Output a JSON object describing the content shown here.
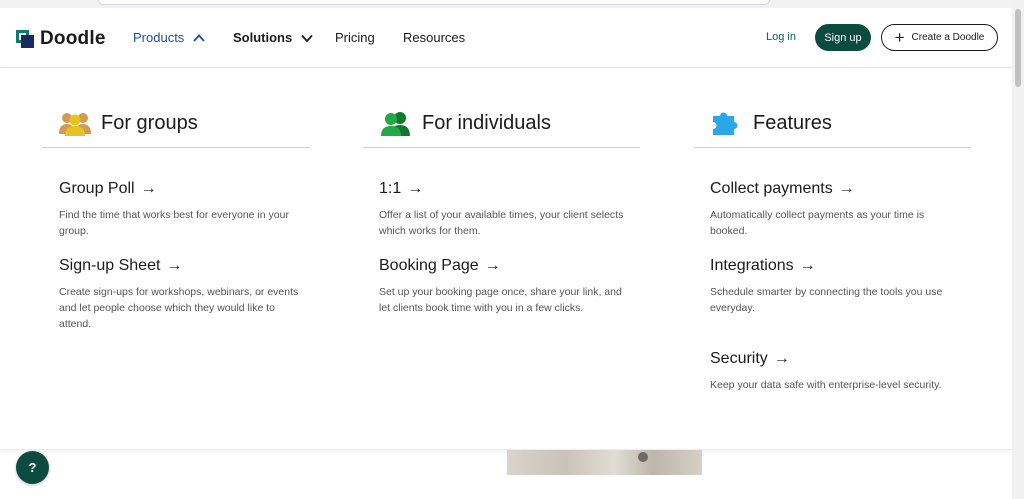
{
  "header": {
    "logo_text": "Doodle",
    "nav": [
      {
        "label": "Products",
        "icon": "chevron-up-icon"
      },
      {
        "label": "Solutions",
        "icon": "chevron-down-icon"
      },
      {
        "label": "Pricing"
      },
      {
        "label": "Resources"
      }
    ],
    "login_label": "Log in",
    "signup_label": "Sign up",
    "create_label": "Create a Doodle",
    "create_icon": "+"
  },
  "menu": {
    "groups": {
      "heading": "For groups",
      "icon": "group-icon",
      "icon_color": "#c98a3c",
      "items": [
        {
          "title": "Group Poll",
          "desc": "Find the time that works best for everyone in your group."
        },
        {
          "title": "Sign-up Sheet",
          "desc": "Create sign-ups for workshops, webinars, or events and let people choose which they would like to attend."
        }
      ]
    },
    "individuals": {
      "heading": "For individuals",
      "icon": "individuals-icon",
      "icon_color": "#1f9a3a",
      "items": [
        {
          "title": "1:1",
          "desc": "Offer a list of your available times, your client selects which works for them."
        },
        {
          "title": "Booking Page",
          "desc": "Set up your booking page once, share your link, and let clients book time with you in a few clicks."
        }
      ]
    },
    "features": {
      "heading": "Features",
      "icon": "puzzle-icon",
      "icon_color": "#2aa7e8",
      "items": [
        {
          "title": "Collect payments",
          "desc": "Automatically collect payments as your time is booked."
        },
        {
          "title": "Integrations",
          "desc": "Schedule smarter by connecting the tools you use everyday."
        },
        {
          "title": "Security",
          "desc": "Keep your data safe with enterprise-level security."
        }
      ]
    },
    "arrow": "→"
  },
  "help_label": "?",
  "colors": {
    "brand_dark": "#0b4b40",
    "nav_active": "#1e4f9c",
    "logo_teal": "#0a7c6e",
    "logo_navy": "#1a2b5f"
  }
}
